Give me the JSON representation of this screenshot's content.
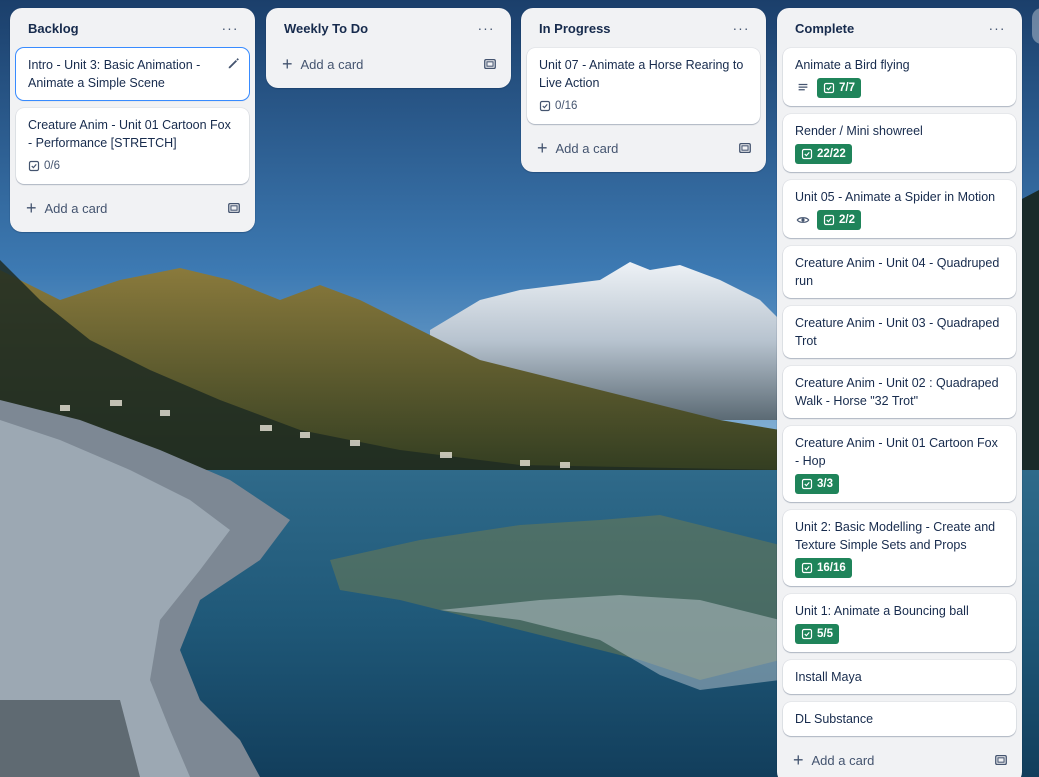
{
  "colors": {
    "list_bg": "#f1f2f4",
    "card_bg": "#ffffff",
    "done_badge": "#1f845a",
    "focus_ring": "#388bff"
  },
  "lists": [
    {
      "title": "Backlog",
      "cards": [
        {
          "title": "Intro - Unit 3: Basic Animation - Animate a Simple Scene",
          "focused": true
        },
        {
          "title": "Creature Anim - Unit 01 Cartoon Fox - Performance [STRETCH]",
          "checklist": "0/6",
          "checklist_complete": false
        }
      ],
      "add_label": "Add a card"
    },
    {
      "title": "Weekly To Do",
      "cards": [],
      "add_label": "Add a card"
    },
    {
      "title": "In Progress",
      "cards": [
        {
          "title": "Unit 07 - Animate a Horse Rearing to Live Action",
          "checklist": "0/16",
          "checklist_complete": false
        }
      ],
      "add_label": "Add a card"
    },
    {
      "title": "Complete",
      "cards": [
        {
          "title": "Animate a Bird flying",
          "description_icon": true,
          "checklist": "7/7",
          "checklist_complete": true
        },
        {
          "title": "Render / Mini showreel",
          "checklist": "22/22",
          "checklist_complete": true
        },
        {
          "title": "Unit 05 - Animate a Spider in Motion",
          "watch_icon": true,
          "checklist": "2/2",
          "checklist_complete": true
        },
        {
          "title": "Creature Anim - Unit 04 - Quadruped run"
        },
        {
          "title": "Creature Anim - Unit 03 - Quadraped Trot"
        },
        {
          "title": "Creature Anim - Unit 02 : Quadraped Walk - Horse \"32 Trot\""
        },
        {
          "title": "Creature Anim - Unit 01 Cartoon Fox - Hop",
          "checklist": "3/3",
          "checklist_complete": true
        },
        {
          "title": "Unit 2: Basic Modelling - Create and Texture Simple Sets and Props",
          "checklist": "16/16",
          "checklist_complete": true
        },
        {
          "title": "Unit 1: Animate a Bouncing ball",
          "checklist": "5/5",
          "checklist_complete": true
        },
        {
          "title": "Install Maya"
        },
        {
          "title": "DL Substance"
        }
      ],
      "add_label": "Add a card"
    }
  ]
}
